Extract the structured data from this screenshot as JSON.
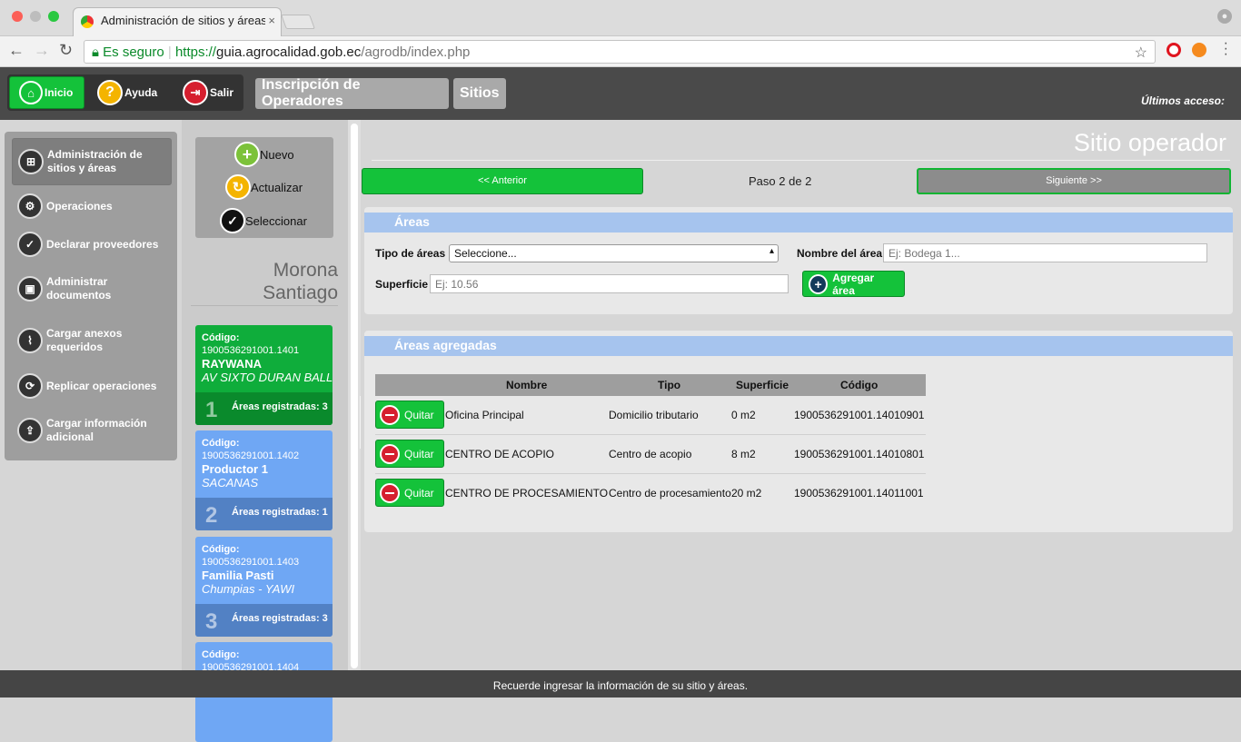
{
  "browser": {
    "tab_title": "Administración de sitios y áreas",
    "tab_close": "×",
    "secure_label": "Es seguro",
    "url_scheme": "https://",
    "url_host": "guia.agrocalidad.gob.ec",
    "url_path": "/agrodb/index.php",
    "back": "←",
    "forward": "→",
    "reload": "↻",
    "star": "☆"
  },
  "appbar": {
    "inicio": "Inicio",
    "ayuda": "Ayuda",
    "salir": "Salir",
    "inscripcion": "Inscripción de Operadores",
    "sitios": "Sitios",
    "last_access": "Últimos acceso:"
  },
  "left_menu": [
    {
      "label": "Administración de sitios y áreas",
      "icon": "sitemap-icon"
    },
    {
      "label": "Operaciones",
      "icon": "operations-icon"
    },
    {
      "label": "Declarar proveedores",
      "icon": "checklist-icon"
    },
    {
      "label": "Administrar documentos",
      "icon": "briefcase-icon"
    },
    {
      "label": "Cargar anexos requeridos",
      "icon": "paperclip-icon"
    },
    {
      "label": "Replicar operaciones",
      "icon": "replicate-icon"
    },
    {
      "label": "Cargar información adicional",
      "icon": "upload-icon"
    }
  ],
  "actions": {
    "nuevo": "Nuevo",
    "actualizar": "Actualizar",
    "seleccionar": "Seleccionar"
  },
  "location": "Morona Santiago",
  "sites": [
    {
      "code_label": "Código:",
      "code": "1900536291001.1401",
      "name": "RAYWANA",
      "address": "AV SIXTO DURAN BALLE...",
      "number": "1",
      "areas_label": "Áreas registradas:",
      "areas": "3"
    },
    {
      "code_label": "Código:",
      "code": "1900536291001.1402",
      "name": "Productor 1",
      "address": "SACANAS",
      "number": "2",
      "areas_label": "Áreas registradas:",
      "areas": "1"
    },
    {
      "code_label": "Código:",
      "code": "1900536291001.1403",
      "name": "Familia Pasti",
      "address": "Chumpias - YAWI",
      "number": "3",
      "areas_label": "Áreas registradas:",
      "areas": "3"
    },
    {
      "code_label": "Código:",
      "code": "1900536291001.1404"
    }
  ],
  "main": {
    "title": "Sitio operador",
    "prev": "<< Anterior",
    "step": "Paso 2 de 2",
    "next": "Siguiente >>",
    "areas_header": "Áreas",
    "tipo_label": "Tipo de áreas",
    "tipo_value": "Seleccione...",
    "nombre_label": "Nombre del área",
    "nombre_placeholder": "Ej: Bodega 1...",
    "superficie_label": "Superficie",
    "superficie_placeholder": "Ej: 10.56",
    "add_button": "Agregar área",
    "added_header": "Áreas agregadas",
    "columns": [
      "Nombre",
      "Tipo",
      "Superficie",
      "Código"
    ],
    "remove_label": "Quitar",
    "rows": [
      [
        "Oficina Principal",
        "Domicilio tributario",
        "0 m2",
        "1900536291001.14010901"
      ],
      [
        "CENTRO DE ACOPIO",
        "Centro de acopio",
        "8 m2",
        "1900536291001.14010801"
      ],
      [
        "CENTRO DE PROCESAMIENTO",
        "Centro de procesamiento",
        "20 m2",
        "1900536291001.14011001"
      ]
    ]
  },
  "status": "Recuerde ingresar la información de su sitio y áreas."
}
